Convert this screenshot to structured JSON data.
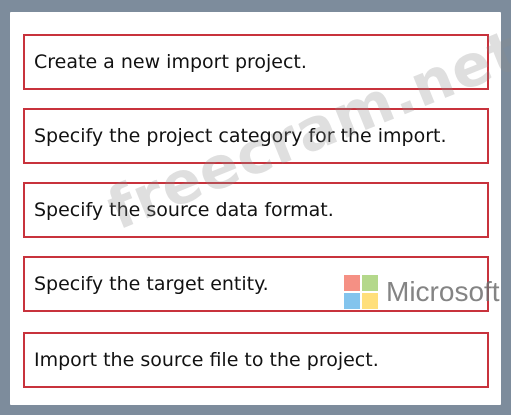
{
  "steps": [
    {
      "label": "Create a new import project."
    },
    {
      "label": "Specify the project category for the import."
    },
    {
      "label": "Specify the source data format."
    },
    {
      "label": "Specify the target entity."
    },
    {
      "label": "Import the source file to the project."
    }
  ],
  "watermark": {
    "text": "freecram.net"
  },
  "logo": {
    "text": "Microsoft"
  },
  "colors": {
    "frame_border": "#c8323c",
    "outer_background": "#7d8c9c",
    "panel_background": "#ffffff"
  }
}
